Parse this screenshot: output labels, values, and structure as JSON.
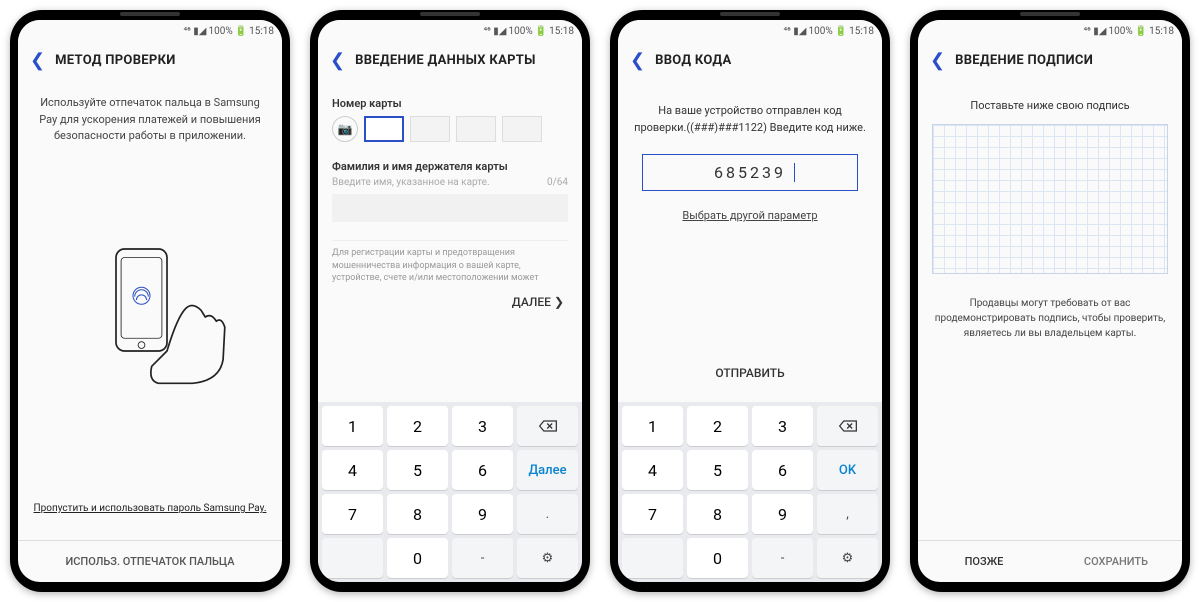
{
  "status": {
    "signal": "⁴⁶ ▮◢",
    "battery": "100%",
    "time": "15:18"
  },
  "s1": {
    "title": "МЕТОД ПРОВЕРКИ",
    "msg": "Используйте отпечаток пальца в Samsung Pay для ускорения платежей и повышения безопасности работы в приложении.",
    "skip": "Пропустить и использовать пароль Samsung Pay.",
    "footer": "ИСПОЛЬЗ. ОТПЕЧАТОК ПАЛЬЦА"
  },
  "s2": {
    "title": "ВВЕДЕНИЕ ДАННЫХ КАРТЫ",
    "card_label": "Номер карты",
    "name_label": "Фамилия и имя держателя карты",
    "name_placeholder": "Введите имя, указанное на карте.",
    "name_counter": "0/64",
    "note": "Для регистрации карты и предотвращения мошенничества информация о вашей карте, устройстве, счете и/или местоположении может",
    "next": "ДАЛЕЕ  ❯",
    "keypad": {
      "next": "Далее"
    }
  },
  "s3": {
    "title": "ВВОД КОДА",
    "msg": "На ваше устройство отправлен код проверки.((###)###1122) Введите код ниже.",
    "code": "685239",
    "alt": "Выбрать другой параметр",
    "send": "ОТПРАВИТЬ",
    "keypad": {
      "ok": "OK"
    }
  },
  "s4": {
    "title": "ВВЕДЕНИЕ ПОДПИСИ",
    "msg": "Поставьте ниже свою подпись",
    "note": "Продавцы могут требовать от вас продемонстрировать подпись, чтобы проверить, являетесь ли вы владельцем карты.",
    "later": "ПОЗЖЕ",
    "save": "СОХРАНИТЬ"
  },
  "keys": {
    "n1": "1",
    "n2": "2",
    "n3": "3",
    "n4": "4",
    "n5": "5",
    "n6": "6",
    "n7": "7",
    "n8": "8",
    "n9": "9",
    "n0": "0",
    "dash": "-",
    "dot": ".",
    "comma": ","
  }
}
